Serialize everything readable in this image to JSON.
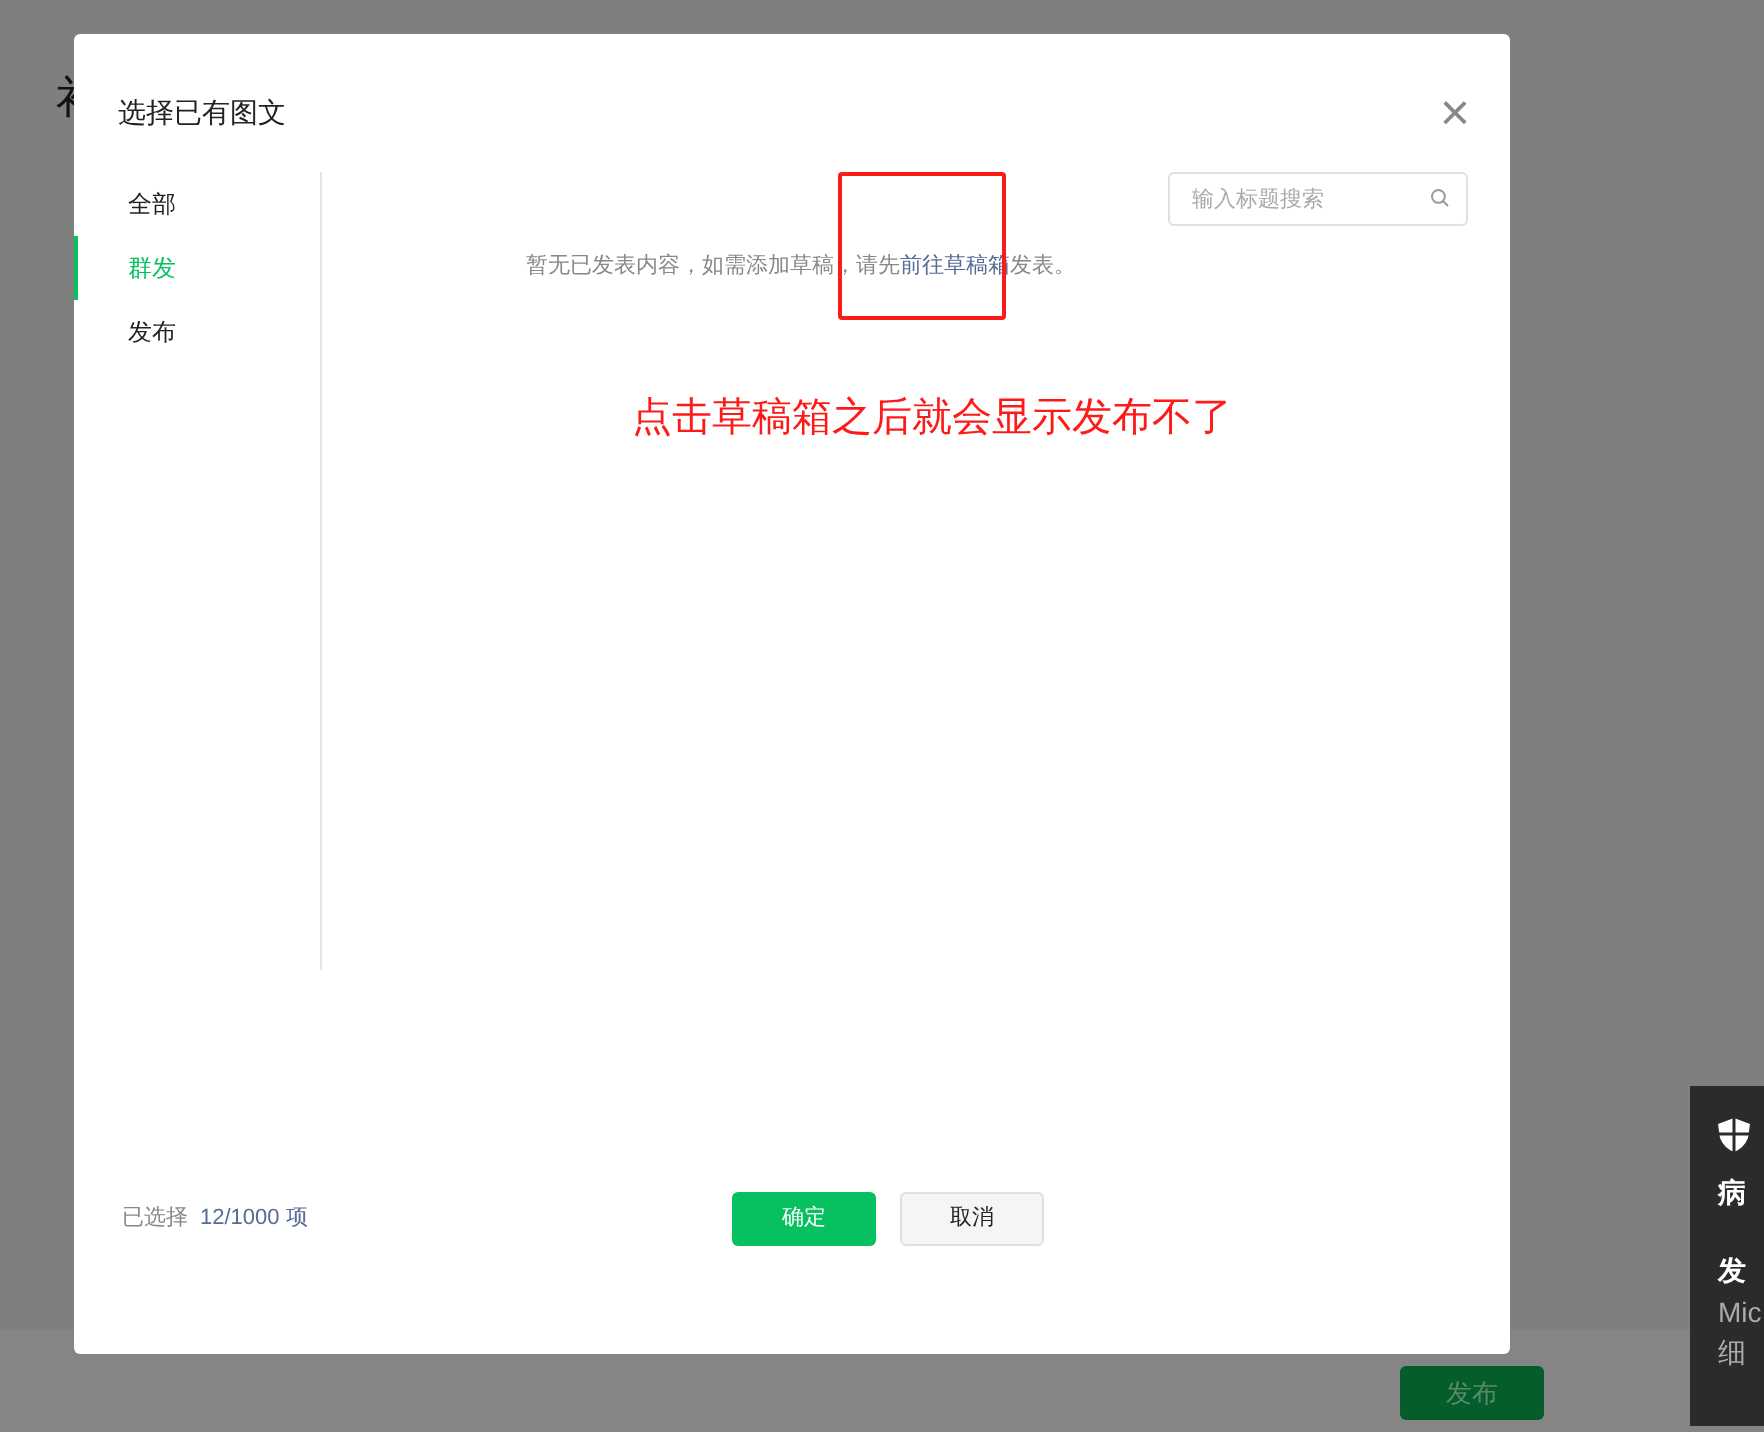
{
  "background_page": {
    "title_fragment": "衤",
    "publish_button": "发布"
  },
  "dialog": {
    "title": "选择已有图文",
    "close": "×",
    "sidebar": [
      {
        "label": "全部",
        "selected": false
      },
      {
        "label": "群发",
        "selected": true
      },
      {
        "label": "发布",
        "selected": false
      }
    ],
    "search": {
      "placeholder": "输入标题搜索"
    },
    "empty_message": {
      "before": "暂无已发表内容，如需添加草稿，请先",
      "link": "前往草稿箱",
      "after": "发表。"
    },
    "annotation": "点击草稿箱之后就会显示发布不了",
    "selection": {
      "label": "已选择",
      "count": "12/1000 项"
    },
    "buttons": [
      {
        "label": "确定",
        "kind": "primary"
      },
      {
        "label": "取消",
        "kind": "secondary"
      }
    ]
  },
  "toast": {
    "lines": [
      "病",
      "发",
      "Mic",
      "细"
    ]
  }
}
